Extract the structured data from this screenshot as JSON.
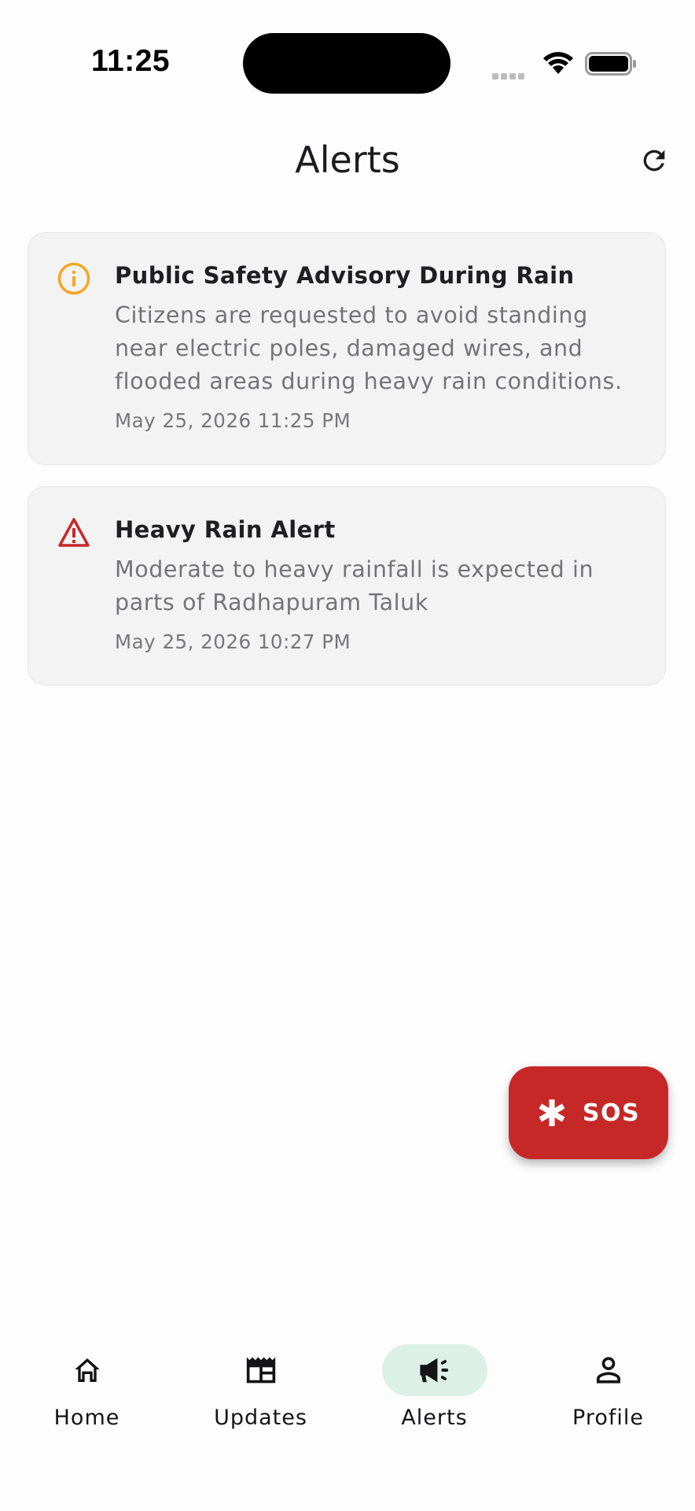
{
  "status_bar": {
    "time": "11:25"
  },
  "app_bar": {
    "title": "Alerts",
    "refresh_icon": "refresh-icon"
  },
  "alerts": [
    {
      "icon": "info-icon",
      "icon_color": "#f5a623",
      "title": "Public Safety Advisory During Rain",
      "description": "Citizens are requested to avoid standing near electric poles, damaged wires, and flooded areas during heavy rain conditions.",
      "timestamp": "May 25, 2026 11:25 PM"
    },
    {
      "icon": "warning-icon",
      "icon_color": "#c62828",
      "title": "Heavy Rain Alert",
      "description": "Moderate to heavy rainfall is expected in parts of Radhapuram Taluk",
      "timestamp": "May 25, 2026 10:27 PM"
    }
  ],
  "sos": {
    "label": "SOS",
    "icon": "asterisk-icon",
    "color": "#c62828"
  },
  "bottom_nav": {
    "active_color": "#dcf0e8",
    "items": [
      {
        "label": "Home",
        "icon": "home-icon"
      },
      {
        "label": "Updates",
        "icon": "newspaper-icon"
      },
      {
        "label": "Alerts",
        "icon": "megaphone-icon",
        "active": true
      },
      {
        "label": "Profile",
        "icon": "person-icon"
      }
    ]
  }
}
